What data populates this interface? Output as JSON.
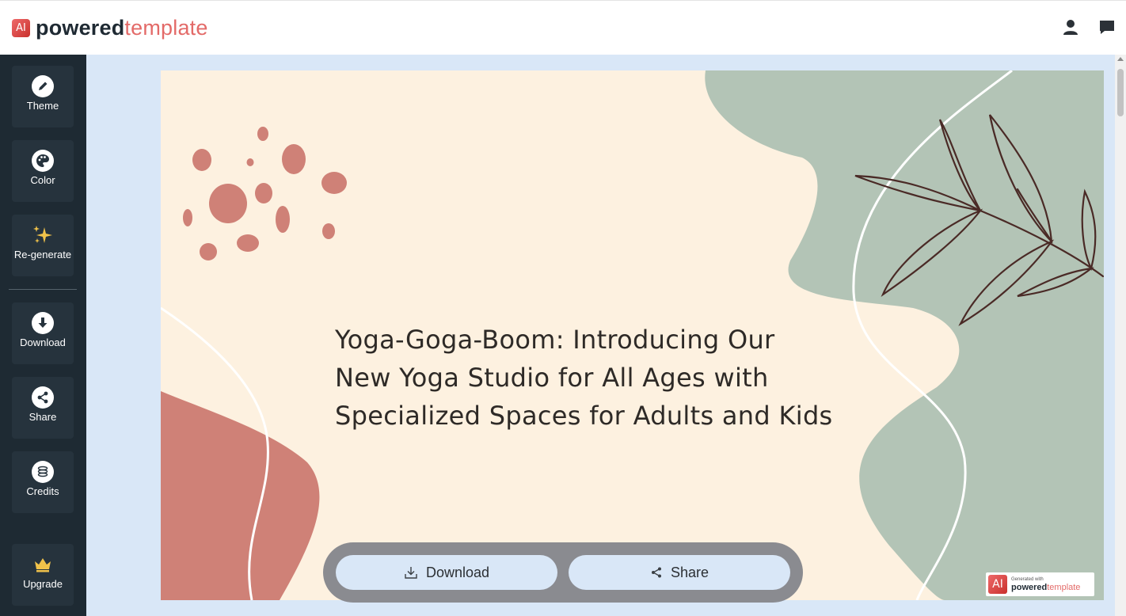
{
  "header": {
    "logo_mark": "AI",
    "logo_bold": "powered",
    "logo_light": "template",
    "icons": [
      "user-icon",
      "chat-icon"
    ]
  },
  "sidebar": {
    "items": [
      {
        "label": "Theme",
        "icon": "pencil-icon"
      },
      {
        "label": "Color",
        "icon": "palette-icon"
      },
      {
        "label": "Re-generate",
        "icon": "sparkles-icon"
      },
      {
        "label": "Download",
        "icon": "download-circle-icon"
      },
      {
        "label": "Share",
        "icon": "share-circle-icon"
      },
      {
        "label": "Credits",
        "icon": "coins-icon"
      },
      {
        "label": "Upgrade",
        "icon": "crown-icon"
      }
    ]
  },
  "slide": {
    "title_lines": [
      "Yoga-Goga-Boom: Introducing Our",
      "New Yoga Studio for All Ages with",
      "Specialized Spaces for Adults and Kids"
    ],
    "watermark": {
      "mark": "AI",
      "small_text": "Generated with",
      "brand_bold": "powered",
      "brand_light": "template"
    }
  },
  "actions": {
    "download_label": "Download",
    "share_label": "Share"
  },
  "colors": {
    "sidebar_bg": "#1e2a33",
    "main_bg": "#d9e7f7",
    "slide_bg": "#fdf1e0",
    "sage": "#b3c4b6",
    "terracotta": "#cf8177",
    "brand_red": "#e36a68"
  }
}
